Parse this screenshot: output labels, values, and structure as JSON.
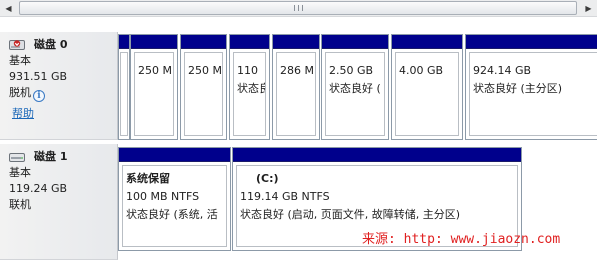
{
  "scrollbar": {
    "left_arrow": "◀",
    "right_arrow": "▶"
  },
  "disks": [
    {
      "name": "磁盘 0",
      "type": "基本",
      "size": "931.51 GB",
      "status": "脱机",
      "help_link": "帮助",
      "status_icon": "disk-offline-icon",
      "partitions": [
        {
          "size": "",
          "status": ""
        },
        {
          "size": "250 M",
          "status": ""
        },
        {
          "size": "250 M",
          "status": ""
        },
        {
          "size": "110",
          "status": "状态良"
        },
        {
          "size": "286 M",
          "status": ""
        },
        {
          "size": "2.50 GB",
          "status": "状态良好 ("
        },
        {
          "size": "4.00 GB",
          "status": ""
        },
        {
          "size": "924.14 GB",
          "status": "状态良好 (主分区)"
        }
      ]
    },
    {
      "name": "磁盘 1",
      "type": "基本",
      "size": "119.24 GB",
      "status": "联机",
      "status_icon": "disk-online-icon",
      "partitions": [
        {
          "title": "系统保留",
          "size": "100 MB NTFS",
          "status": "状态良好 (系统, 活"
        },
        {
          "title": "(C:)",
          "size": "119.14 GB NTFS",
          "status": "状态良好 (启动, 页面文件, 故障转储, 主分区)"
        }
      ]
    }
  ],
  "watermark": "来源: http: www.jiaozn.com",
  "colors": {
    "partition_bar": "#00008c",
    "link": "#1b67b8",
    "watermark": "#e02020"
  }
}
